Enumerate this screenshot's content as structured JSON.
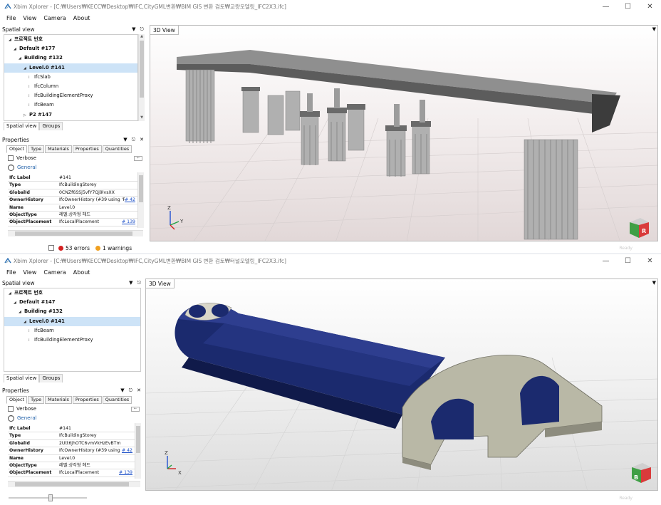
{
  "windows": [
    {
      "title": "Xbim Xplorer - [C:₩Users₩KECC₩Desktop₩IFC,CityGML변환₩BIM GIS 변환 검토₩교량모델링_IFC2X3.ifc]",
      "menu": [
        "File",
        "View",
        "Camera",
        "About"
      ],
      "spatial_view": {
        "title": "Spatial view",
        "tree": [
          {
            "label": "프로젝트 번호",
            "level": 0,
            "expanded": true
          },
          {
            "label": "Default #177",
            "level": 1,
            "expanded": true
          },
          {
            "label": "Building #132",
            "level": 2,
            "expanded": true
          },
          {
            "label": "Level.0 #141",
            "level": 3,
            "expanded": true,
            "selected": true
          },
          {
            "label": "IfcSlab",
            "level": 4,
            "leaf": true
          },
          {
            "label": "IfcColumn",
            "level": 4,
            "leaf": true
          },
          {
            "label": "IfcBuildingElementProxy",
            "level": 4,
            "leaf": true
          },
          {
            "label": "IfcBeam",
            "level": 4,
            "leaf": true
          },
          {
            "label": "P2 #147",
            "level": 3,
            "expanded": false
          }
        ],
        "tabs": [
          "Spatial view",
          "Groups"
        ]
      },
      "properties": {
        "title": "Properties",
        "tabs": [
          "Object",
          "Type",
          "Materials",
          "Properties",
          "Quantities"
        ],
        "verbose": "Verbose",
        "group": "General",
        "rows": [
          {
            "key": "Ifc Label",
            "value": "#141",
            "link": ""
          },
          {
            "key": "Type",
            "value": "IfcBuildingStorey",
            "link": ""
          },
          {
            "key": "GlobalId",
            "value": "0CNZf6SSj5vfY7Qj9lvsXX",
            "link": ""
          },
          {
            "key": "OwnerHistory",
            "value": "IfcOwnerHistory (#39 using 'Re",
            "link": "# 42"
          },
          {
            "key": "Name",
            "value": "Level.0",
            "link": ""
          },
          {
            "key": "ObjectType",
            "value": "레벨:상각형 헤드",
            "link": ""
          },
          {
            "key": "ObjectPlacement",
            "value": "IfcLocalPlacement",
            "link": "# 139"
          }
        ]
      },
      "viewport_tab": "3D View",
      "status": {
        "errors": "53 errors",
        "warnings": "1 warnings",
        "ready": "Ready"
      }
    },
    {
      "title": "Xbim Xplorer - [C:₩Users₩KECC₩Desktop₩IFC,CityGML변환₩BIM GIS 변환 검토₩터널모델링_IFC2X3.ifc]",
      "menu": [
        "File",
        "View",
        "Camera",
        "About"
      ],
      "spatial_view": {
        "title": "Spatial view",
        "tree": [
          {
            "label": "프로젝트 번호",
            "level": 0,
            "expanded": true
          },
          {
            "label": "Default #147",
            "level": 1,
            "expanded": true
          },
          {
            "label": "Building #132",
            "level": 2,
            "expanded": true
          },
          {
            "label": "Level.0 #141",
            "level": 3,
            "expanded": true,
            "selected": true
          },
          {
            "label": "IfcBeam",
            "level": 4,
            "leaf": true
          },
          {
            "label": "IfcBuildingElementProxy",
            "level": 4,
            "leaf": true
          }
        ],
        "tabs": [
          "Spatial view",
          "Groups"
        ]
      },
      "properties": {
        "title": "Properties",
        "tabs": [
          "Object",
          "Type",
          "Materials",
          "Properties",
          "Quantities"
        ],
        "verbose": "Verbose",
        "group": "General",
        "rows": [
          {
            "key": "Ifc Label",
            "value": "#141",
            "link": ""
          },
          {
            "key": "Type",
            "value": "IfcBuildingStorey",
            "link": ""
          },
          {
            "key": "GlobalId",
            "value": "2Utt6jhOTC6vmVkHzEvBTm",
            "link": ""
          },
          {
            "key": "OwnerHistory",
            "value": "IfcOwnerHistory (#39 using '",
            "link": "# 42"
          },
          {
            "key": "Name",
            "value": "Level.0",
            "link": ""
          },
          {
            "key": "ObjectType",
            "value": "레벨:상각형 헤드",
            "link": ""
          },
          {
            "key": "ObjectPlacement",
            "value": "IfcLocalPlacement",
            "link": "# 139"
          }
        ]
      },
      "viewport_tab": "3D View",
      "status": {
        "ready": "Ready"
      }
    }
  ],
  "axis_labels": {
    "z": "Z",
    "y": "Y",
    "x": "X"
  },
  "icons": [
    "app-icon",
    "minimize-icon",
    "maximize-icon",
    "close-icon",
    "dropdown-icon",
    "pin-icon",
    "view-cube-icon"
  ],
  "colors": {
    "error": "#d42020",
    "warning": "#f0a020",
    "selection": "#cde3f7",
    "link": "#1a4ec7",
    "tunnel": "#1b2a6e",
    "portal": "#b9b8a6"
  }
}
